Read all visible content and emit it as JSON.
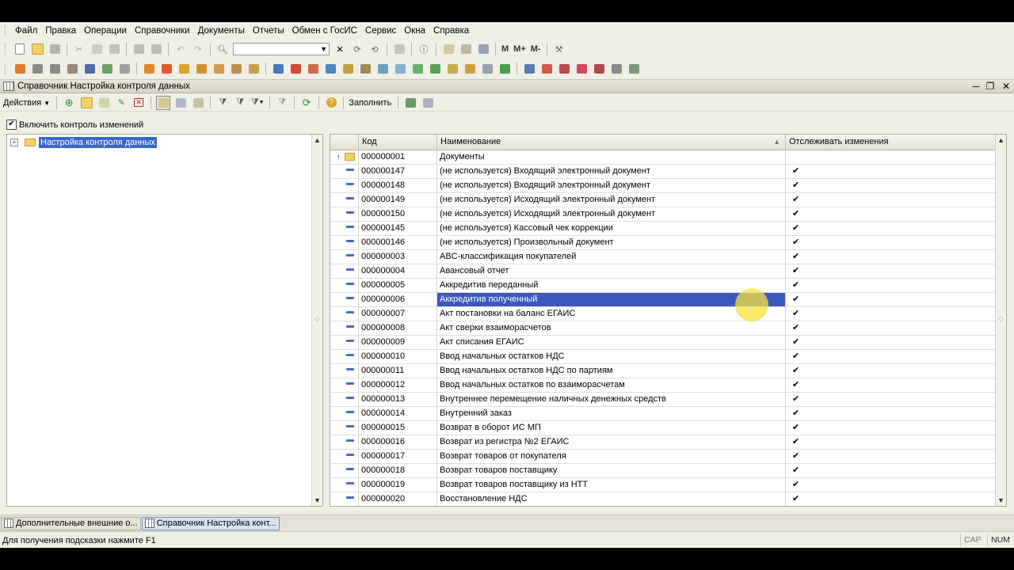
{
  "menu": [
    "Файл",
    "Правка",
    "Операции",
    "Справочники",
    "Документы",
    "Отчеты",
    "Обмен с ГосИС",
    "Сервис",
    "Окна",
    "Справка"
  ],
  "toolbar1": {
    "m_buttons": [
      "M",
      "M+",
      "M-"
    ]
  },
  "window": {
    "title": "Справочник Настройка контроля данных"
  },
  "form_toolbar": {
    "actions_label": "Действия",
    "fill_label": "Заполнить"
  },
  "checkbox": {
    "label": "Включить контроль изменений",
    "checked_mark": "✔"
  },
  "tree": {
    "root_label": "Настройка контроля данных"
  },
  "grid": {
    "headers": [
      "Код",
      "Наименование",
      "Отслеживать изменения"
    ],
    "sort_mark": "▲",
    "rows": [
      {
        "code": "000000001",
        "name": "Документы",
        "track": "",
        "type": "folder"
      },
      {
        "code": "000000147",
        "name": "(не используется) Входящий электронный документ",
        "track": "✔",
        "type": "item"
      },
      {
        "code": "000000148",
        "name": "(не используется) Входящий электронный документ",
        "track": "✔",
        "type": "item"
      },
      {
        "code": "000000149",
        "name": "(не используется) Исходящий электронный документ",
        "track": "✔",
        "type": "item"
      },
      {
        "code": "000000150",
        "name": "(не используется) Исходящий электронный документ",
        "track": "✔",
        "type": "item"
      },
      {
        "code": "000000145",
        "name": "(не используется) Кассовый чек коррекции",
        "track": "✔",
        "type": "item"
      },
      {
        "code": "000000146",
        "name": "(не используется) Произвольный документ",
        "track": "✔",
        "type": "item"
      },
      {
        "code": "000000003",
        "name": "ABC-классификация покупателей",
        "track": "✔",
        "type": "item"
      },
      {
        "code": "000000004",
        "name": "Авансовый отчет",
        "track": "✔",
        "type": "item"
      },
      {
        "code": "000000005",
        "name": "Аккредитив переданный",
        "track": "✔",
        "type": "item"
      },
      {
        "code": "000000006",
        "name": "Аккредитив полученный",
        "track": "✔",
        "type": "item",
        "selected": true
      },
      {
        "code": "000000007",
        "name": "Акт постановки на баланс ЕГАИС",
        "track": "✔",
        "type": "item"
      },
      {
        "code": "000000008",
        "name": "Акт сверки взаиморасчетов",
        "track": "✔",
        "type": "item"
      },
      {
        "code": "000000009",
        "name": "Акт списания ЕГАИС",
        "track": "✔",
        "type": "item"
      },
      {
        "code": "000000010",
        "name": "Ввод начальных остатков НДС",
        "track": "✔",
        "type": "item"
      },
      {
        "code": "000000011",
        "name": "Ввод начальных остатков НДС по партиям",
        "track": "✔",
        "type": "item"
      },
      {
        "code": "000000012",
        "name": "Ввод начальных остатков по взаиморасчетам",
        "track": "✔",
        "type": "item"
      },
      {
        "code": "000000013",
        "name": "Внутреннее перемещение наличных денежных средств",
        "track": "✔",
        "type": "item"
      },
      {
        "code": "000000014",
        "name": "Внутренний заказ",
        "track": "✔",
        "type": "item"
      },
      {
        "code": "000000015",
        "name": "Возврат в оборот ИС МП",
        "track": "✔",
        "type": "item"
      },
      {
        "code": "000000016",
        "name": "Возврат из регистра №2 ЕГАИС",
        "track": "✔",
        "type": "item"
      },
      {
        "code": "000000017",
        "name": "Возврат товаров от покупателя",
        "track": "✔",
        "type": "item"
      },
      {
        "code": "000000018",
        "name": "Возврат товаров поставщику",
        "track": "✔",
        "type": "item"
      },
      {
        "code": "000000019",
        "name": "Возврат товаров поставщику из НТТ",
        "track": "✔",
        "type": "item"
      },
      {
        "code": "000000020",
        "name": "Восстановление НДС",
        "track": "✔",
        "type": "item"
      }
    ]
  },
  "taskbar": [
    "Дополнительные внешние о...",
    "Справочник Настройка конт..."
  ],
  "status": {
    "hint": "Для получения подсказки нажмите F1",
    "cap": "CAP",
    "num": "NUM"
  },
  "colors": {
    "selection": "#3a58c0",
    "background": "#f0efe6",
    "highlight": "#f5e23c"
  }
}
